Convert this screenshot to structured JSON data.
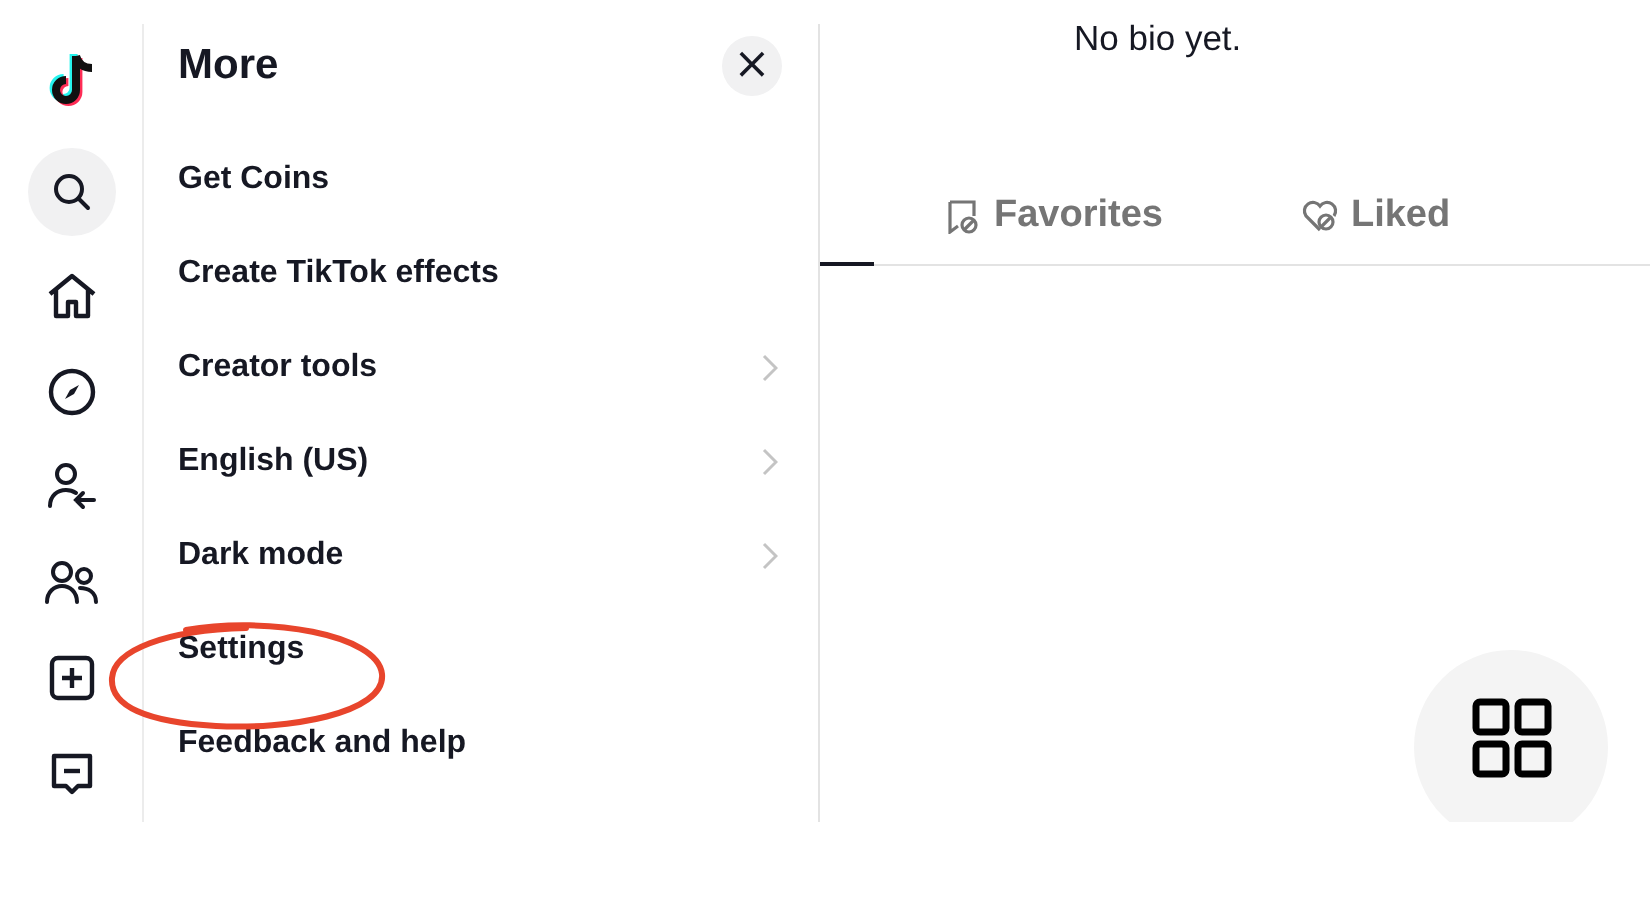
{
  "rail": {
    "items": [
      {
        "kind": "logo",
        "selected": false
      },
      {
        "kind": "search",
        "selected": true
      },
      {
        "kind": "home",
        "selected": false
      },
      {
        "kind": "explore",
        "selected": false
      },
      {
        "kind": "following",
        "selected": false
      },
      {
        "kind": "friends",
        "selected": false
      },
      {
        "kind": "upload",
        "selected": false
      },
      {
        "kind": "messages",
        "selected": false
      }
    ]
  },
  "more_panel": {
    "title": "More",
    "close": "×",
    "items": [
      {
        "label": "Get Coins",
        "submenu": false
      },
      {
        "label": "Create TikTok effects",
        "submenu": false
      },
      {
        "label": "Creator tools",
        "submenu": true
      },
      {
        "label": "English (US)",
        "submenu": true
      },
      {
        "label": "Dark mode",
        "submenu": true
      },
      {
        "label": "Settings",
        "submenu": false,
        "circled": true
      },
      {
        "label": "Feedback and help",
        "submenu": false
      }
    ]
  },
  "profile": {
    "bio": "No bio yet.",
    "tabs": [
      {
        "label": "Favorites",
        "kind": "favorites",
        "selected": false
      },
      {
        "label": "Liked",
        "kind": "liked",
        "selected": false
      }
    ]
  }
}
